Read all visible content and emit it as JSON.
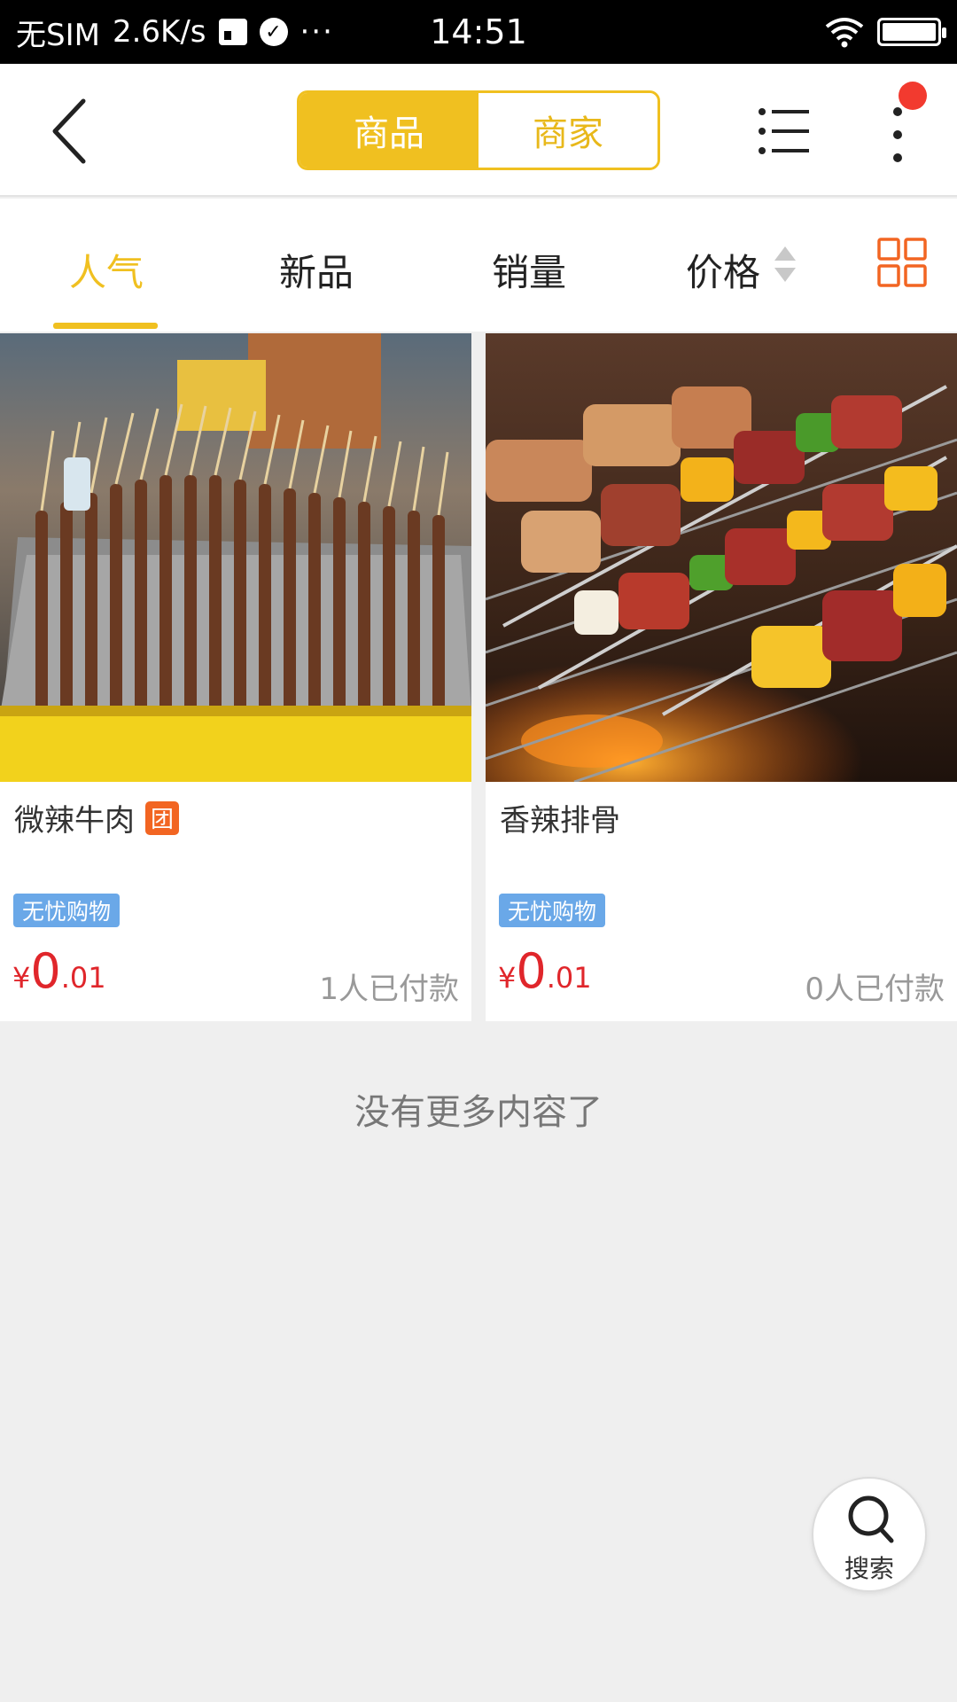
{
  "status_bar": {
    "carrier": "无SIM",
    "speed": "2.6K/s",
    "more": "···",
    "time": "14:51"
  },
  "header": {
    "segments": [
      "商品",
      "商家"
    ],
    "active_segment": "商品"
  },
  "sort_tabs": {
    "popular": "人气",
    "new": "新品",
    "sales": "销量",
    "price": "价格",
    "active": "人气"
  },
  "products": [
    {
      "title": "微辣牛肉",
      "badge": "团",
      "tag": "无忧购物",
      "currency": "¥",
      "price_int": "0",
      "price_dec": ".01",
      "sold": "1人已付款",
      "image": "grilled-beef-skewers-photo"
    },
    {
      "title": "香辣排骨",
      "badge": "",
      "tag": "无忧购物",
      "currency": "¥",
      "price_int": "0",
      "price_dec": ".01",
      "sold": "0人已付款",
      "image": "bbq-kebab-skewers-photo"
    }
  ],
  "footer": {
    "no_more": "没有更多内容了"
  },
  "search_fab": {
    "label": "搜索"
  },
  "colors": {
    "accent": "#f0c020",
    "price": "#e0262b",
    "tag": "#6aa8e8",
    "badge": "#f26522",
    "notification": "#f23a2f"
  }
}
